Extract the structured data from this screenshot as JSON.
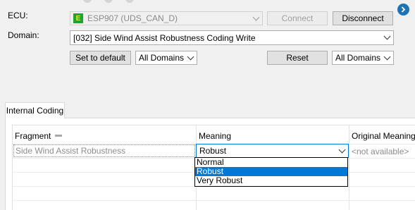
{
  "ecu": {
    "label": "ECU:",
    "badge": "E",
    "value": "ESP907 (UDS_CAN_D)",
    "connect_label": "Connect",
    "disconnect_label": "Disconnect"
  },
  "domain": {
    "label": "Domain:",
    "value": "[032] Side Wind Assist Robustness Coding Write"
  },
  "toolbar": {
    "set_default_label": "Set to default",
    "domains_filter_1": "All Domains",
    "reset_label": "Reset",
    "domains_filter_2": "All Domains"
  },
  "tabs": [
    {
      "label": "Internal Coding"
    }
  ],
  "table": {
    "columns": [
      "Fragment",
      "Meaning",
      "Original Meaning"
    ],
    "rows": [
      {
        "fragment": "Side Wind Assist Robustness",
        "meaning": "Robust",
        "original": "<not available>"
      }
    ]
  },
  "dropdown": {
    "options": [
      "Normal",
      "Robust",
      "Very Robust"
    ],
    "selected": "Robust"
  },
  "colors": {
    "selection": "#0078d7",
    "badge_bg": "#1ea52d",
    "badge_fg": "#f3e814",
    "nav_icon": "#1e73b5"
  },
  "icons": [
    "navigate-right-icon",
    "chevron-down-icon",
    "column-drag-icon"
  ]
}
